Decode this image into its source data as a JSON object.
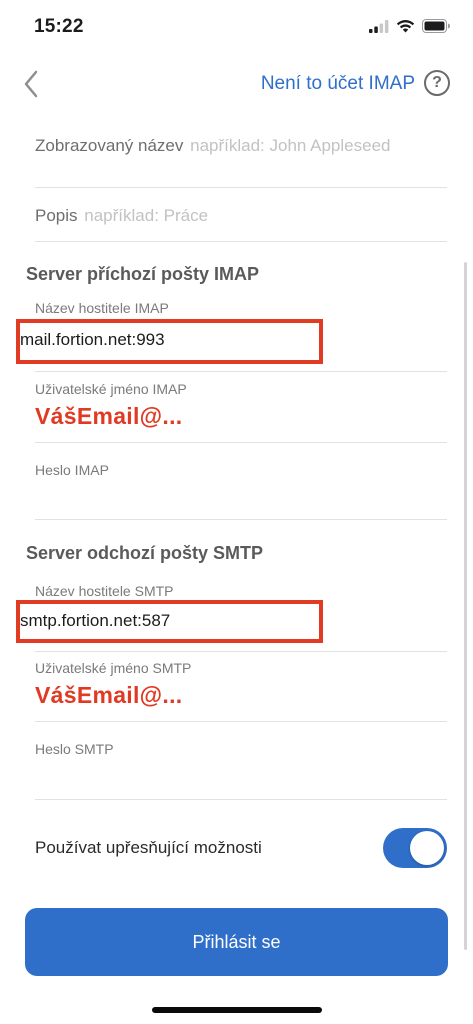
{
  "status_bar": {
    "time": "15:22",
    "icons": [
      "signal-icon",
      "wifi-icon",
      "battery-icon"
    ]
  },
  "nav": {
    "back_icon": "chevron-left-icon",
    "not_imap_link": "Není to účet IMAP",
    "help_icon": "question-circle-icon",
    "help_glyph": "?"
  },
  "fields": {
    "display_name": {
      "label": "Zobrazovaný název",
      "placeholder": "například: John Appleseed"
    },
    "description": {
      "label": "Popis",
      "placeholder": "například: Práce"
    }
  },
  "imap": {
    "section_title": "Server příchozí pošty IMAP",
    "host_label": "Název hostitele IMAP",
    "host_value": "mail.fortion.net:993",
    "username_label": "Uživatelské jméno IMAP",
    "username_value": "VášEmail@...",
    "password_label": "Heslo IMAP"
  },
  "smtp": {
    "section_title": "Server odchozí pošty SMTP",
    "host_label": "Název hostitele SMTP",
    "host_value": "smtp.fortion.net:587",
    "username_label": "Uživatelské jméno SMTP",
    "username_value": "VášEmail@...",
    "password_label": "Heslo SMTP"
  },
  "advanced": {
    "label": "Používat upřesňující možnosti",
    "enabled": true
  },
  "login_button": "Přihlásit se",
  "colors": {
    "accent": "#2f6fca",
    "highlight": "#e23b24",
    "email_text": "#e03a22"
  }
}
